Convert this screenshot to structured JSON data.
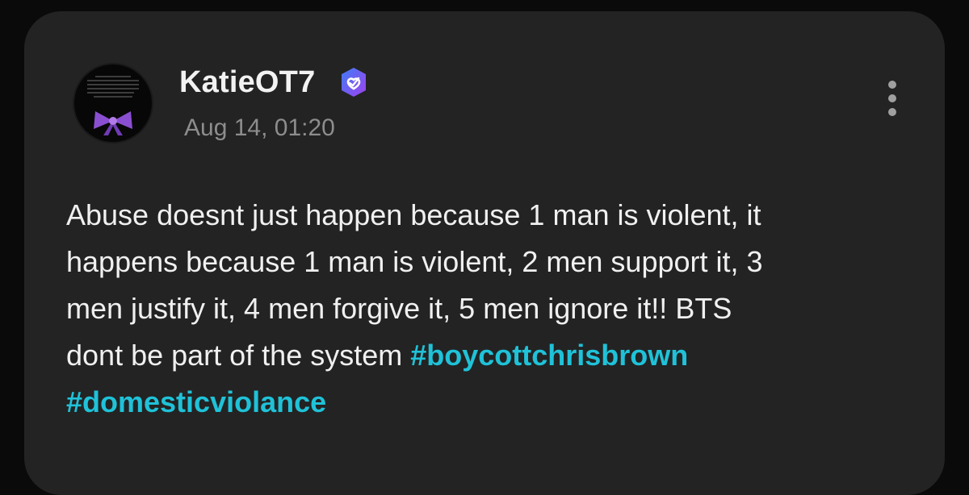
{
  "post": {
    "author": {
      "username": "KatieOT7",
      "verified": true,
      "avatar_icon": "avatar-bow-image",
      "verified_icon": "verified-badge-icon"
    },
    "timestamp": "Aug 14, 01:20",
    "menu_icon": "more-vertical-icon",
    "body": {
      "lines": [
        "Abuse doesnt just happen because 1 man is violent, it",
        "happens because 1 man is violent, 2 men support it, 3",
        "men justify it, 4 men forgive it, 5 men ignore it!! BTS"
      ],
      "last_text": "dont be part of the system ",
      "hashtags": [
        "#boycottchrisbrown",
        "#domesticviolance"
      ]
    }
  },
  "colors": {
    "card_background": "#232323",
    "text": "#f0f0f0",
    "timestamp": "#8d8d8d",
    "hashtag": "#1fc2d8",
    "verified_badge_start": "#3f7cf5",
    "verified_badge_end": "#a042f0"
  }
}
